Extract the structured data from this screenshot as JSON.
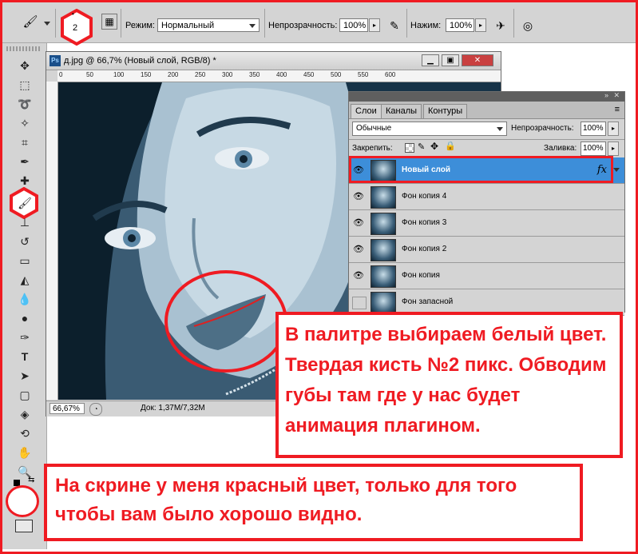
{
  "options_bar": {
    "brush_size": "2",
    "mode_label": "Режим:",
    "mode_value": "Нормальный",
    "opacity_label": "Непрозрачность:",
    "opacity_value": "100%",
    "pressure_label": "Нажим:",
    "pressure_value": "100%"
  },
  "document": {
    "app_badge": "Ps",
    "title": "д.jpg @ 66,7% (Новый слой, RGB/8) *",
    "ruler_marks": [
      "0",
      "50",
      "100",
      "150",
      "200",
      "250",
      "300",
      "350",
      "400",
      "450",
      "500",
      "550",
      "600"
    ],
    "zoom": "66,67%",
    "doc_info": "Док: 1,37М/7,32М"
  },
  "layers_panel": {
    "tabs": [
      "Слои",
      "Каналы",
      "Контуры"
    ],
    "blend_mode": "Обычные",
    "opacity_label": "Непрозрачность:",
    "opacity_value": "100%",
    "lock_label": "Закрепить:",
    "fill_label": "Заливка:",
    "fill_value": "100%",
    "fx_label": "fx",
    "layers": [
      {
        "name": "Новый слой",
        "selected": true,
        "visible": true
      },
      {
        "name": "Фон копия 4",
        "selected": false,
        "visible": true
      },
      {
        "name": "Фон копия 3",
        "selected": false,
        "visible": true
      },
      {
        "name": "Фон копия 2",
        "selected": false,
        "visible": true
      },
      {
        "name": "Фон копия",
        "selected": false,
        "visible": true
      },
      {
        "name": "Фон запасной",
        "selected": false,
        "visible": false
      }
    ]
  },
  "annotations": {
    "main_text": "В палитре выбираем белый цвет. Твердая кисть №2 пикс. Обводим губы там где у нас будет анимация плагином.",
    "bottom_text": "На скрине у меня красный цвет, только для того чтобы вам было хорошо видно."
  },
  "colors": {
    "annotation_red": "#ef1b22",
    "selected_layer": "#3d8ed9",
    "ui_gray": "#d4d4d4"
  }
}
